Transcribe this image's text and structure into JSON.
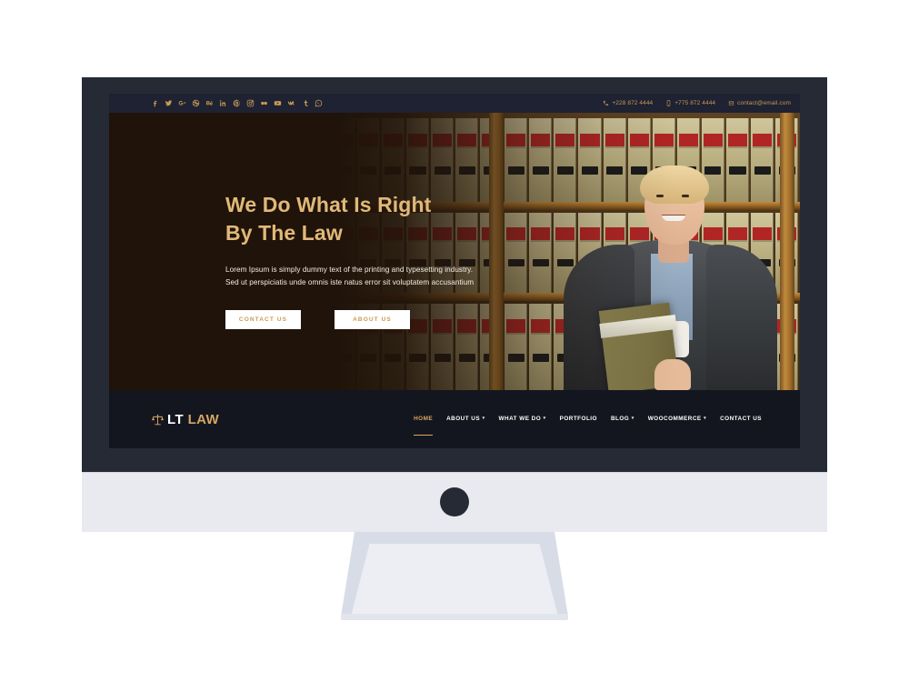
{
  "topbar": {
    "socials": [
      {
        "name": "facebook-icon",
        "glyph": "f"
      },
      {
        "name": "twitter-icon",
        "glyph": "t"
      },
      {
        "name": "google-plus-icon",
        "glyph": "G+"
      },
      {
        "name": "dribbble-icon",
        "glyph": "d"
      },
      {
        "name": "behance-icon",
        "glyph": "b"
      },
      {
        "name": "linkedin-icon",
        "glyph": "in"
      },
      {
        "name": "pinterest-icon",
        "glyph": "p"
      },
      {
        "name": "instagram-icon",
        "glyph": "ig"
      },
      {
        "name": "flickr-icon",
        "glyph": "fl"
      },
      {
        "name": "youtube-icon",
        "glyph": "yt"
      },
      {
        "name": "vk-icon",
        "glyph": "vk"
      },
      {
        "name": "tumblr-icon",
        "glyph": "tu"
      },
      {
        "name": "whatsapp-icon",
        "glyph": "wa"
      }
    ],
    "phone_primary": "+228 872 4444",
    "phone_secondary": "+775 872 4444",
    "email": "contact@email.com"
  },
  "hero": {
    "title_line1": "We Do What Is Right",
    "title_line2": "By The Law",
    "paragraph_line1": "Lorem Ipsum is simply dummy text of the printing and typesetting industry.",
    "paragraph_line2": "Sed ut perspiciatis unde omnis iste natus error sit voluptatem accusantium",
    "button_primary": "CONTACT US",
    "button_secondary": "ABOUT US",
    "image_alt": "smiling female judge in black robe holding a law book in front of a law library bookshelf"
  },
  "brand": {
    "icon": "scales-of-justice-icon",
    "name_part1": "LT",
    "name_part2": " LAW"
  },
  "nav": {
    "items": [
      {
        "label": "HOME",
        "has_caret": false,
        "active": true
      },
      {
        "label": "ABOUT US",
        "has_caret": true,
        "active": false
      },
      {
        "label": "WHAT WE DO",
        "has_caret": true,
        "active": false
      },
      {
        "label": "PORTFOLIO",
        "has_caret": false,
        "active": false
      },
      {
        "label": "BLOG",
        "has_caret": true,
        "active": false
      },
      {
        "label": "WOOCOMMERCE",
        "has_caret": true,
        "active": false
      },
      {
        "label": "CONTACT US",
        "has_caret": false,
        "active": false
      }
    ],
    "caret_glyph": "▾"
  },
  "colors": {
    "accent_gold": "#d7a662",
    "topbar_bg": "#1e2232",
    "navbar_bg": "#14161f",
    "bezel": "#252a35",
    "chin": "#e8eaef",
    "hero_overlay": "#201309"
  },
  "device": {
    "type": "desktop-monitor-mockup"
  }
}
